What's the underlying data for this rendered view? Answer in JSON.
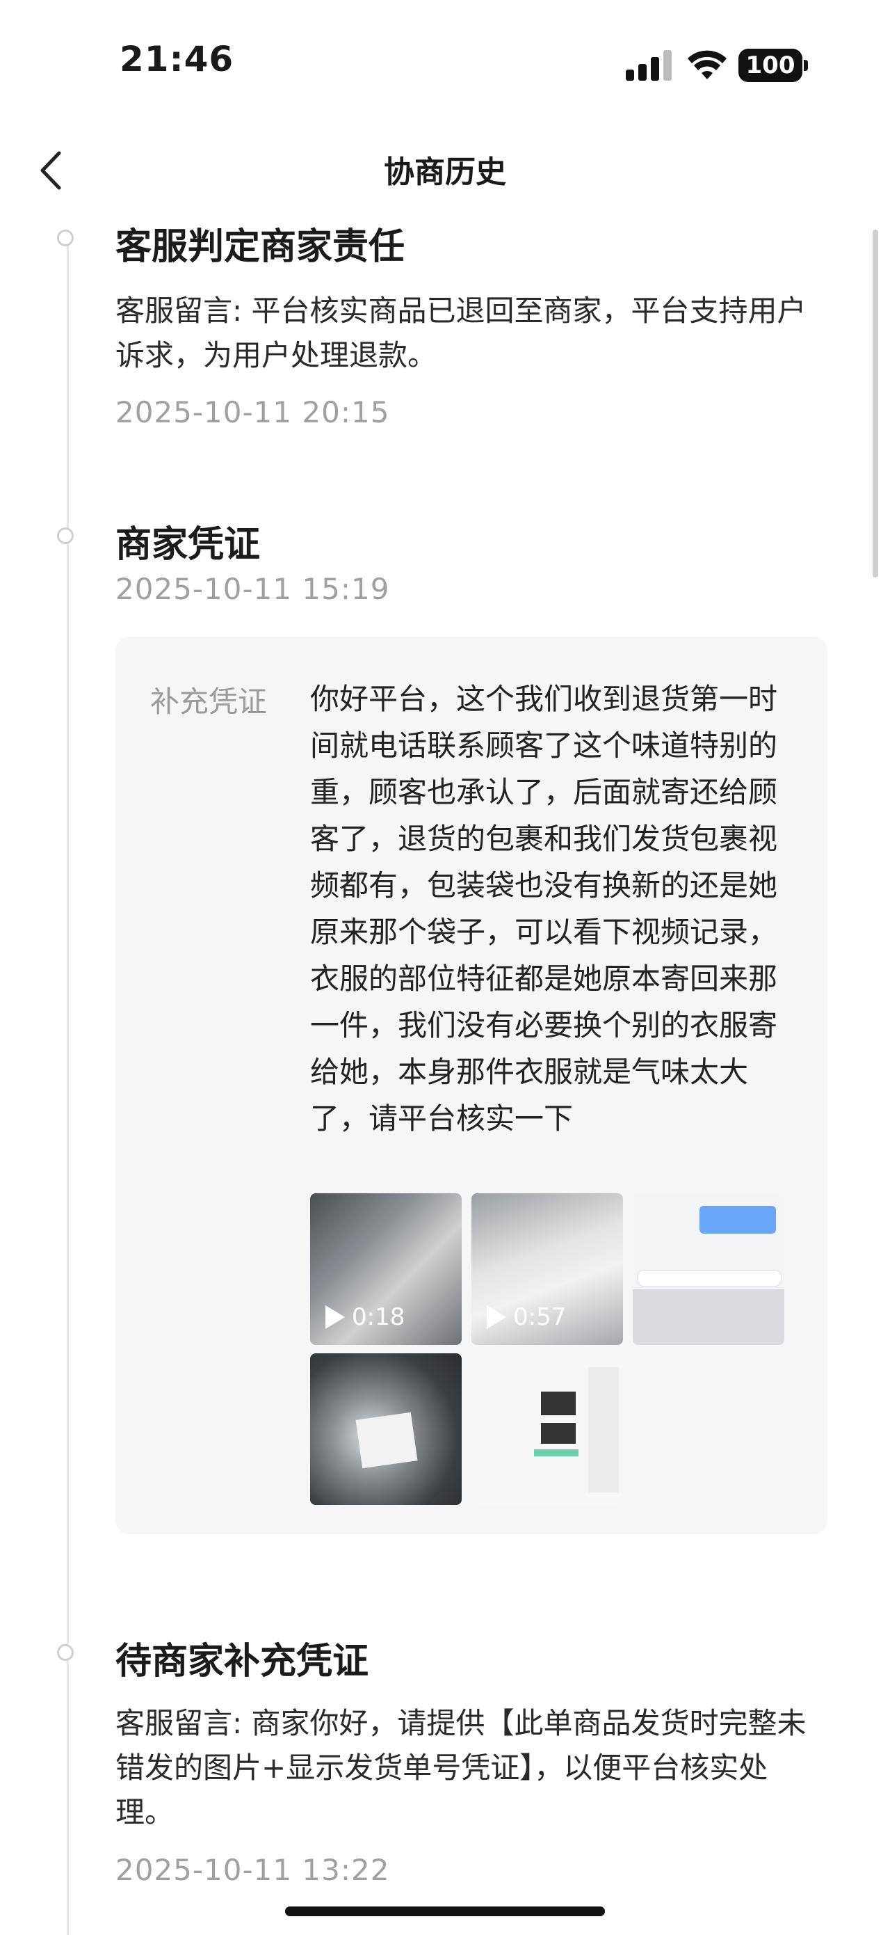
{
  "status_bar": {
    "time": "21:46",
    "battery": "100"
  },
  "nav": {
    "title": "协商历史"
  },
  "entries": [
    {
      "title": "客服判定商家责任",
      "message": "客服留言: 平台核实商品已退回至商家，平台支持用户诉求，为用户处理退款。",
      "time": "2025-10-11 20:15"
    },
    {
      "title": "商家凭证",
      "time": "2025-10-11 15:19",
      "evidence": {
        "label": "补充凭证",
        "text": "你好平台，这个我们收到退货第一时间就电话联系顾客了这个味道特别的重，顾客也承认了，后面就寄还给顾客了，退货的包裹和我们发货包裹视频都有，包装袋也没有换新的还是她原来那个袋子，可以看下视频记录，衣服的部位特征都是她原本寄回来那一件，我们没有必要换个别的衣服寄给她，本身那件衣服就是气味太大了，请平台核实一下",
        "media": [
          {
            "kind": "video",
            "duration": "0:18"
          },
          {
            "kind": "video",
            "duration": "0:57"
          },
          {
            "kind": "image"
          },
          {
            "kind": "image"
          },
          {
            "kind": "image"
          }
        ]
      }
    },
    {
      "title": "待商家补充凭证",
      "message": "客服留言: 商家你好，请提供【此单商品发货时完整未错发的图片+显示发货单号凭证】，以便平台核实处理。",
      "time": "2025-10-11 13:22"
    }
  ]
}
